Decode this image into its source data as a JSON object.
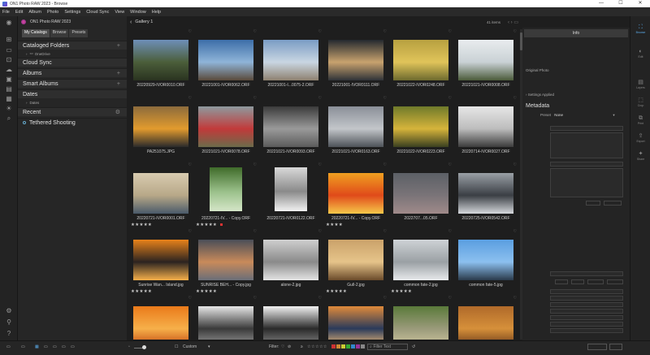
{
  "window": {
    "title": "ON1 Photo RAW 2023 - Browse",
    "controls": [
      "—",
      "☐",
      "✕"
    ]
  },
  "menu": [
    "File",
    "Edit",
    "Album",
    "Photo",
    "Settings",
    "Cloud Sync",
    "View",
    "Window",
    "Help"
  ],
  "left_panel": {
    "app_name": "ON1 Photo RAW 2023",
    "tabs": [
      "My Catalogs",
      "Browse",
      "Presets"
    ],
    "sections": {
      "cataloged_folders": "Cataloged Folders",
      "onedrive": "OneDrive",
      "cloud_sync": "Cloud Sync",
      "albums": "Albums",
      "smart_albums": "Smart Albums",
      "dates": "Dates",
      "dates_sub": "Dates",
      "recent": "Recent",
      "tethered": "Tethered Shooting"
    }
  },
  "center": {
    "gallery_title": "Gallery 1",
    "items_count": "41 items"
  },
  "photos": [
    {
      "name": "20220929-IVOR0010.ORF",
      "stars": "",
      "colors": [
        "#6e8fb8",
        "#4b5e3a",
        "#2a3320"
      ],
      "portrait": false
    },
    {
      "name": "20221001-IVOR0062.ORF",
      "stars": "",
      "colors": [
        "#3d6ea8",
        "#8fb4d8",
        "#5a4a3a"
      ],
      "portrait": false
    },
    {
      "name": "20221001-I...0075-2.ORF",
      "stars": "",
      "colors": [
        "#7a9cc4",
        "#c9d6e2",
        "#8e8170"
      ],
      "portrait": false
    },
    {
      "name": "20221001-IVOR0111.ORF",
      "stars": "",
      "colors": [
        "#24292f",
        "#c8a26e",
        "#2f3338"
      ],
      "portrait": false
    },
    {
      "name": "20221022-IVOR0248.ORF",
      "stars": "",
      "colors": [
        "#b7a040",
        "#e0c45a",
        "#6d6a2e"
      ],
      "portrait": false
    },
    {
      "name": "20221021-IVOR0008.ORF",
      "stars": "",
      "colors": [
        "#e9ecee",
        "#c9d1d5",
        "#4b5b3a"
      ],
      "portrait": false
    },
    {
      "name": "PA251075.JPG",
      "stars": "",
      "colors": [
        "#8c6b3c",
        "#e29b2e",
        "#2b2b2b"
      ],
      "portrait": false
    },
    {
      "name": "20221021-IVOR0078.ORF",
      "stars": "",
      "colors": [
        "#8e9a9e",
        "#c23a3a",
        "#6b6b4a"
      ],
      "portrait": false
    },
    {
      "name": "20221021-IVOR0093.ORF",
      "stars": "",
      "colors": [
        "#3b3b3b",
        "#9a9a9a",
        "#5b5b5b"
      ],
      "portrait": false
    },
    {
      "name": "20221021-IVOR0163.ORF",
      "stars": "",
      "colors": [
        "#8a8f98",
        "#c3c6ca",
        "#4d5258"
      ],
      "portrait": false
    },
    {
      "name": "20221022-IVOR0223.ORF",
      "stars": "",
      "colors": [
        "#6f7a2a",
        "#d6b43b",
        "#3a4020"
      ],
      "portrait": false
    },
    {
      "name": "20220714-IVOR0027.ORF",
      "stars": "",
      "colors": [
        "#e6e6e6",
        "#bdbdbd",
        "#3b3b3b"
      ],
      "portrait": false
    },
    {
      "name": "20220721-IVOR0001.ORF",
      "stars": "★★★★★",
      "colors": [
        "#d8cbb0",
        "#b8a888",
        "#4a5a6a"
      ],
      "portrait": false
    },
    {
      "name": "20220721-IV... - Copy.ORF",
      "stars": "★★★★★",
      "colors": [
        "#3f6b2a",
        "#9ac08a",
        "#d5e6c8"
      ],
      "portrait": true,
      "tag": true
    },
    {
      "name": "20220721-IVOR0122.ORF",
      "stars": "",
      "colors": [
        "#d9d9d9",
        "#8a8a8a",
        "#f2f2f2"
      ],
      "portrait": true
    },
    {
      "name": "20220721-IV... - Copy.ORF",
      "stars": "★★★★",
      "colors": [
        "#f0a020",
        "#e04a1a",
        "#f6c84a"
      ],
      "portrait": false
    },
    {
      "name": "2022707...05.ORF",
      "stars": "",
      "colors": [
        "#5c6066",
        "#7a7478",
        "#a08a8a"
      ],
      "portrait": false
    },
    {
      "name": "20220725-IVOR0542.ORF",
      "stars": "",
      "colors": [
        "#9aa0a6",
        "#3a3e44",
        "#d5d8dc"
      ],
      "portrait": false
    },
    {
      "name": "Sunrise Wan... Island.jpg",
      "stars": "★★★★★",
      "colors": [
        "#e8821a",
        "#2b2320",
        "#f6b04a"
      ],
      "portrait": false
    },
    {
      "name": "SUNRISE BEH... - Copy.jpg",
      "stars": "★★★★★",
      "colors": [
        "#4a4e58",
        "#c88a5a",
        "#6a6e78"
      ],
      "portrait": false
    },
    {
      "name": "alone-2.jpg",
      "stars": "",
      "colors": [
        "#cfcfcf",
        "#8a8a8a",
        "#e4e4e4"
      ],
      "portrait": false
    },
    {
      "name": "Gull-2.jpg",
      "stars": "★★★★★",
      "colors": [
        "#caa26a",
        "#e6c48a",
        "#6a4a2a"
      ],
      "portrait": false
    },
    {
      "name": "common fate-2.jpg",
      "stars": "★★★★★",
      "colors": [
        "#cfd3d6",
        "#9aa0a4",
        "#e8eaec"
      ],
      "portrait": false
    },
    {
      "name": "common fate-5.jpg",
      "stars": "",
      "colors": [
        "#5a9ee0",
        "#8cc0ef",
        "#2a3a4a"
      ],
      "portrait": false
    },
    {
      "name": "",
      "stars": "★★★★★",
      "colors": [
        "#ea7a1a",
        "#f6b04a",
        "#c24a10"
      ],
      "portrait": false
    },
    {
      "name": "",
      "stars": "",
      "colors": [
        "#e6e6e6",
        "#3a3a3a",
        "#9a9a9a"
      ],
      "portrait": false
    },
    {
      "name": "",
      "stars": "",
      "colors": [
        "#f2f2f2",
        "#2a2a2a",
        "#8a8a8a"
      ],
      "portrait": false
    },
    {
      "name": "",
      "stars": "★★★★★",
      "colors": [
        "#e08a3a",
        "#2a3a5a",
        "#f6c07a"
      ],
      "portrait": false
    },
    {
      "name": "",
      "stars": "",
      "colors": [
        "#5a7a3a",
        "#9a9a7a",
        "#cfc6a0"
      ],
      "portrait": false
    },
    {
      "name": "",
      "stars": "",
      "colors": [
        "#b06a2a",
        "#d6903a",
        "#6a3a1a"
      ],
      "portrait": false
    }
  ],
  "right_panel": {
    "info_tab": "Info",
    "original_photo": "Original Photo",
    "settings_applied": "Settings Applied",
    "metadata_title": "Metadata",
    "preset_label": "Preset",
    "preset_value": "None"
  },
  "right_rail": [
    {
      "icon": "⛶",
      "label": "Browse",
      "active": true
    },
    {
      "icon": "◐",
      "label": "Edit",
      "active": false
    },
    {
      "icon": "▤",
      "label": "Layers",
      "active": false
    },
    {
      "icon": "⬚",
      "label": "Crop",
      "active": false
    },
    {
      "icon": "⧉",
      "label": "Print",
      "active": false
    },
    {
      "icon": "⇪",
      "label": "Export",
      "active": false
    },
    {
      "icon": "✦",
      "label": "Share",
      "active": false
    }
  ],
  "bottom_bar": {
    "size_label": "Custom",
    "filter_label": "Filter:",
    "filter_text_placeholder": "Filter Text",
    "color_labels": [
      "#c33",
      "#c83",
      "#cc3",
      "#3a3",
      "#38c",
      "#939",
      "#888"
    ]
  }
}
